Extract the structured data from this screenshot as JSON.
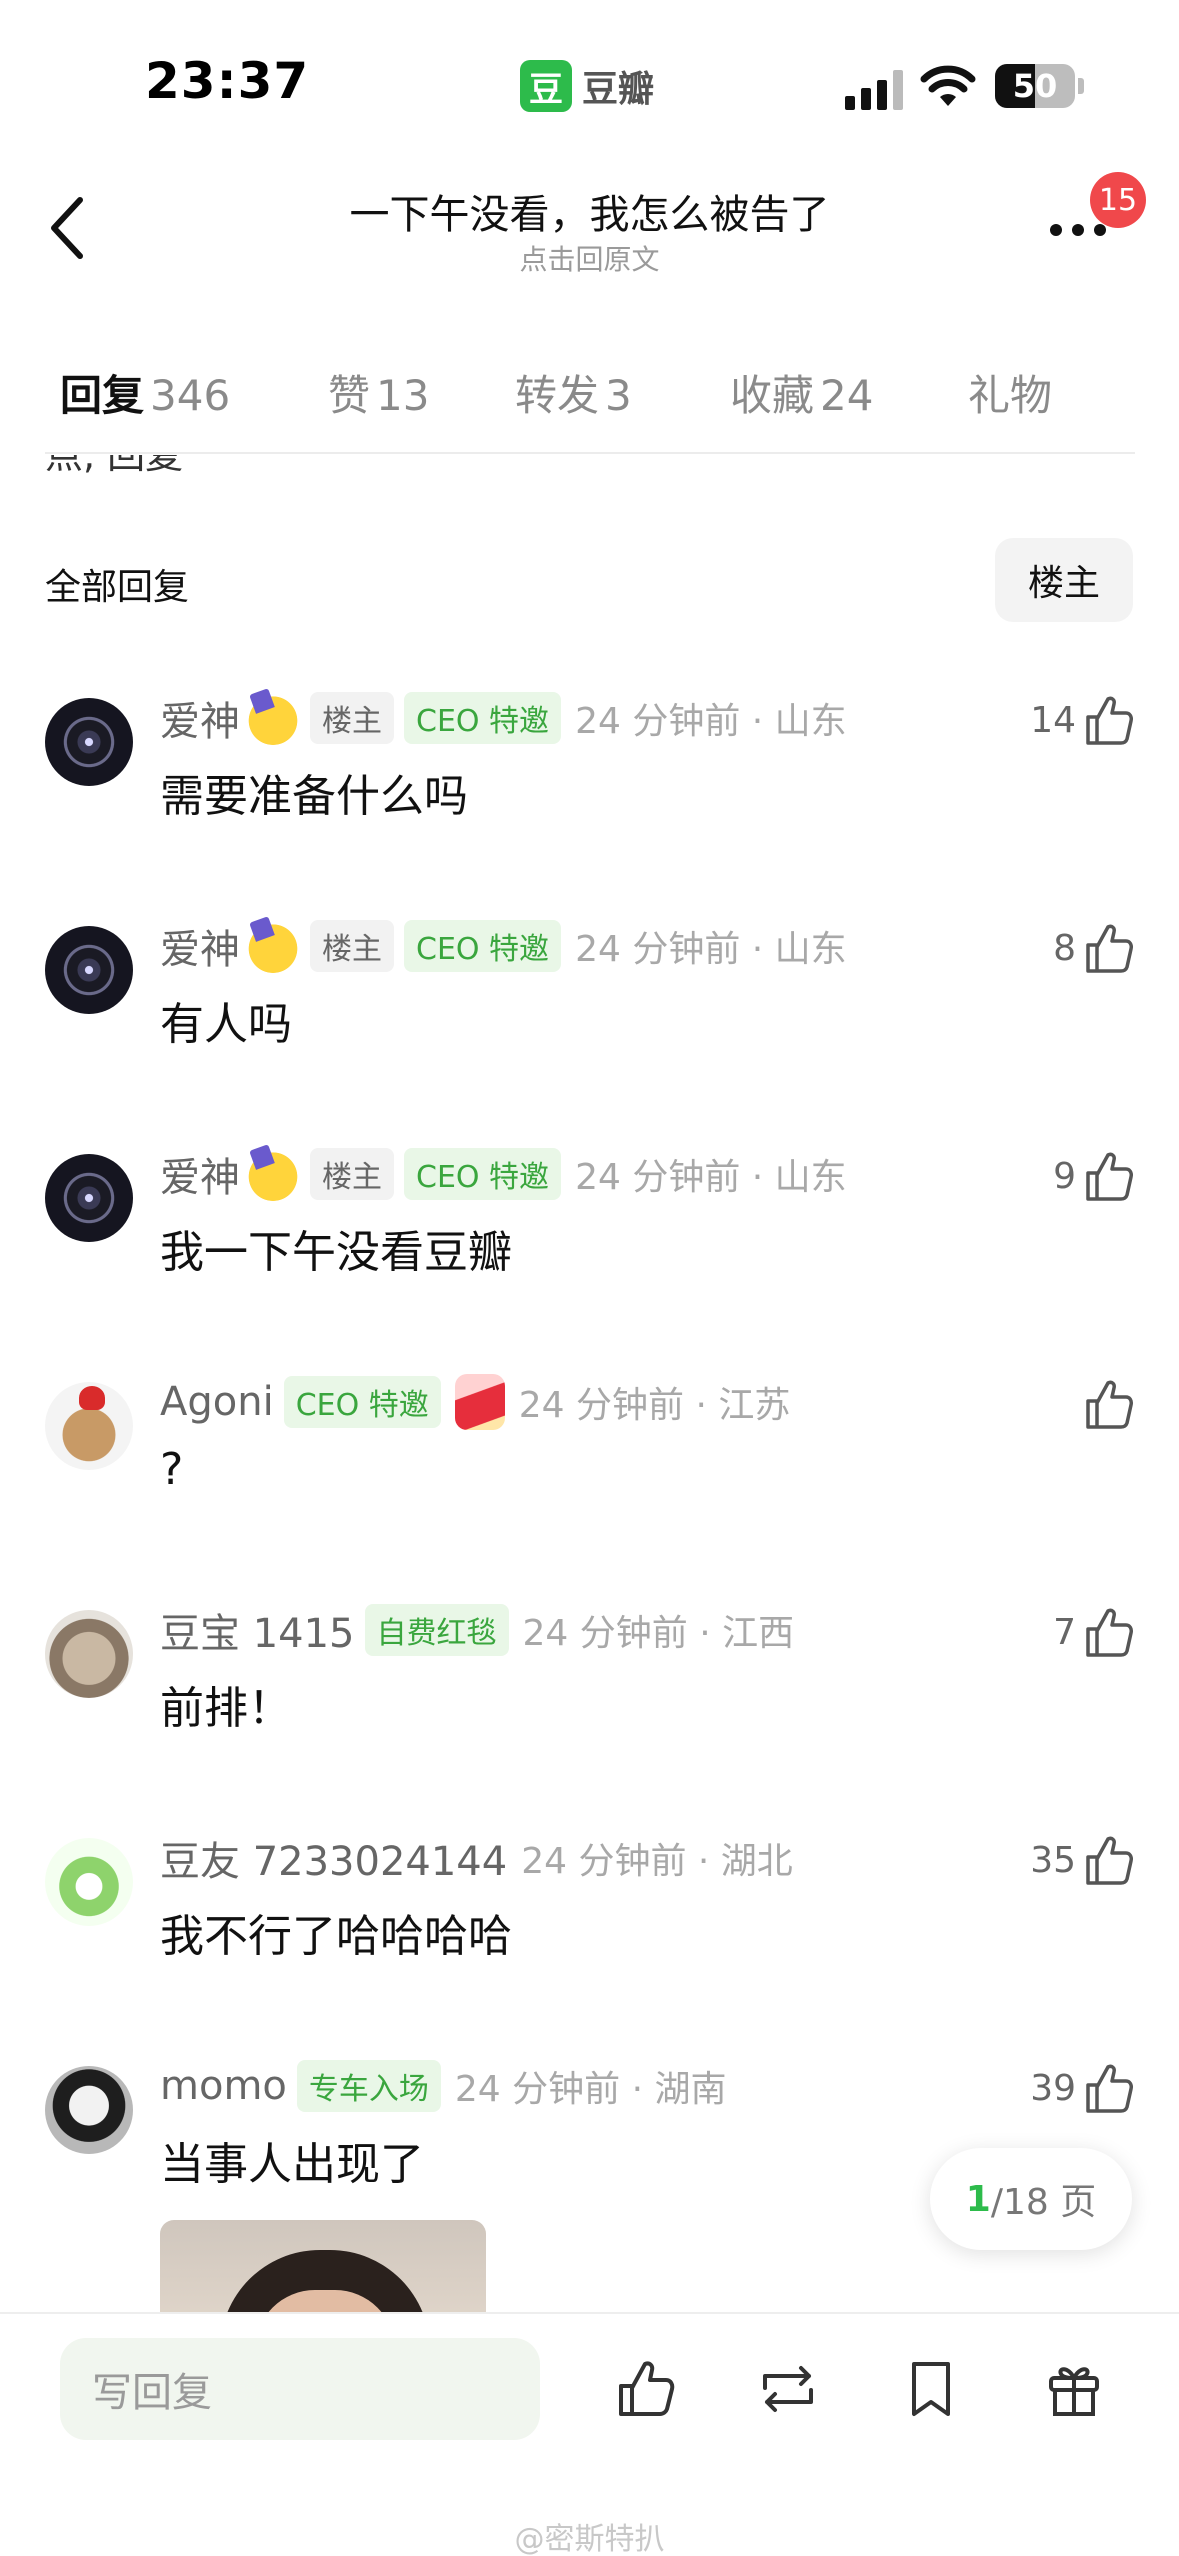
{
  "status_bar": {
    "time": "23:37",
    "app_icon_text": "豆",
    "app_name": "豆瓣",
    "battery": "50",
    "battery_level": 0.5
  },
  "nav": {
    "title": "一下午没看，我怎么被告了",
    "subtitle": "点击回原文",
    "notification_count": "15"
  },
  "tabs": [
    {
      "label": "回复",
      "count": "346",
      "active": true
    },
    {
      "label": "赞",
      "count": "13"
    },
    {
      "label": "转发",
      "count": "3"
    },
    {
      "label": "收藏",
      "count": "24"
    },
    {
      "label": "礼物",
      "count": ""
    }
  ],
  "cut_text": "点, 回复",
  "section": {
    "title": "全部回复",
    "owner_filter": "楼主"
  },
  "comments": [
    {
      "user": "爱神",
      "emoji": "partying-face-icon",
      "tags": [
        "楼主",
        "CEO 特邀"
      ],
      "time_loc": "24 分钟前 · 山东",
      "likes": "14",
      "text": "需要准备什么吗"
    },
    {
      "user": "爱神",
      "emoji": "partying-face-icon",
      "tags": [
        "楼主",
        "CEO 特邀"
      ],
      "time_loc": "24 分钟前 · 山东",
      "likes": "8",
      "text": "有人吗"
    },
    {
      "user": "爱神",
      "emoji": "partying-face-icon",
      "tags": [
        "楼主",
        "CEO 特邀"
      ],
      "time_loc": "24 分钟前 · 山东",
      "likes": "9",
      "text": "我一下午没看豆瓣"
    },
    {
      "user": "Agoni",
      "tags": [
        "CEO 特邀"
      ],
      "sticker": "sticker-icon",
      "time_loc": "24 分钟前 · 江苏",
      "likes": "",
      "text": "?"
    },
    {
      "user": "豆宝 1415",
      "tags": [
        "自费红毯"
      ],
      "time_loc": "24 分钟前 · 江西",
      "likes": "7",
      "text": "前排！"
    },
    {
      "user": "豆友 7233024144",
      "tags": [],
      "time_loc": "24 分钟前 · 湖北",
      "likes": "35",
      "text": "我不行了哈哈哈哈"
    },
    {
      "user": "momo",
      "tags": [
        "专车入场"
      ],
      "time_loc": "24 分钟前 · 湖南",
      "likes": "39",
      "text": "当事人出现了"
    }
  ],
  "pager": {
    "current": "1",
    "total": "/18 页"
  },
  "bottom_bar": {
    "reply_placeholder": "写回复",
    "icons": [
      "like-icon",
      "repost-icon",
      "bookmark-icon",
      "gift-icon"
    ]
  },
  "watermark": "@密斯特扒",
  "colors": {
    "brand_green": "#2dbb4b",
    "badge_red": "#f0484b",
    "tag_green_text": "#3aa63e"
  }
}
